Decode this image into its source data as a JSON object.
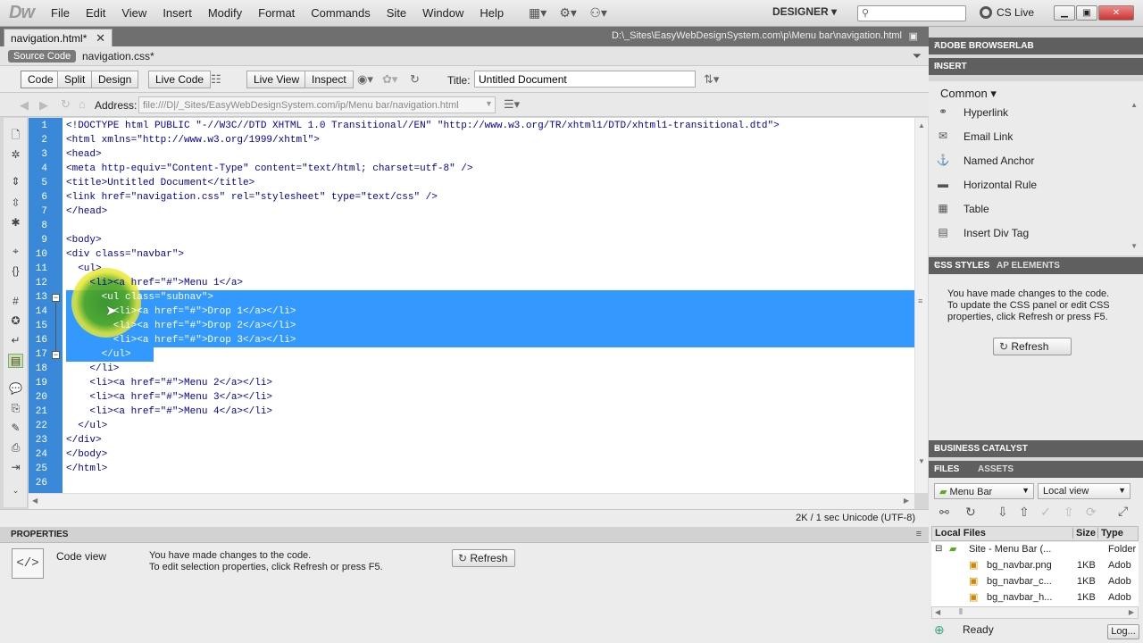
{
  "app": {
    "logo": "Dw"
  },
  "menubar": {
    "items": [
      "File",
      "Edit",
      "View",
      "Insert",
      "Modify",
      "Format",
      "Commands",
      "Site",
      "Window",
      "Help"
    ],
    "workspace": "DESIGNER",
    "cslive": "CS Live"
  },
  "tabs": {
    "active": "navigation.html*",
    "path": "D:\\_Sites\\EasyWebDesignSystem.com\\p\\Menu bar\\navigation.html"
  },
  "related": {
    "source": "Source Code",
    "css": "navigation.css*"
  },
  "doctoolbar": {
    "code": "Code",
    "split": "Split",
    "design": "Design",
    "livecode": "Live Code",
    "liveview": "Live View",
    "inspect": "Inspect",
    "title_label": "Title:",
    "title_value": "Untitled Document"
  },
  "address": {
    "label": "Address:",
    "value": "file:///D|/_Sites/EasyWebDesignSystem.com/ip/Menu bar/navigation.html"
  },
  "code_lines": [
    "<!DOCTYPE html PUBLIC \"-//W3C//DTD XHTML 1.0 Transitional//EN\" \"http://www.w3.org/TR/xhtml1/DTD/xhtml1-transitional.dtd\">",
    "<html xmlns=\"http://www.w3.org/1999/xhtml\">",
    "<head>",
    "<meta http-equiv=\"Content-Type\" content=\"text/html; charset=utf-8\" />",
    "<title>Untitled Document</title>",
    "<link href=\"navigation.css\" rel=\"stylesheet\" type=\"text/css\" />",
    "</head>",
    "",
    "<body>",
    "<div class=\"navbar\">",
    "  <ul>",
    "    <li><a href=\"#\">Menu 1</a>",
    "      <ul class=\"subnav\">",
    "        <li><a href=\"#\">Drop 1</a></li>",
    "        <li><a href=\"#\">Drop 2</a></li>",
    "        <li><a href=\"#\">Drop 3</a></li>",
    "      </ul>",
    "    </li>",
    "    <li><a href=\"#\">Menu 2</a></li>",
    "    <li><a href=\"#\">Menu 3</a></li>",
    "    <li><a href=\"#\">Menu 4</a></li>",
    "  </ul>",
    "</div>",
    "</body>",
    "</html>",
    ""
  ],
  "status": {
    "text": "2K / 1 sec  Unicode (UTF-8)"
  },
  "properties": {
    "title": "PROPERTIES",
    "view": "Code view",
    "msg1": "You have made changes to the code.",
    "msg2": "To edit selection properties, click Refresh or press F5.",
    "refresh": "Refresh"
  },
  "panels": {
    "browserlab": "ADOBE BROWSERLAB",
    "insert": "INSERT",
    "common": "Common",
    "insert_items": [
      "Hyperlink",
      "Email Link",
      "Named Anchor",
      "Horizontal Rule",
      "Table",
      "Insert Div Tag"
    ],
    "css_tab": "CSS STYLES",
    "ap_tab": "AP ELEMENTS",
    "css_msg": [
      "You have made changes to the code.",
      "To update the CSS panel or edit CSS",
      "properties, click Refresh or press F5."
    ],
    "css_refresh": "Refresh",
    "bc": "BUSINESS CATALYST",
    "files_tab": "FILES",
    "assets_tab": "ASSETS",
    "site_select": "Menu Bar",
    "view_select": "Local view",
    "files_header": {
      "name": "Local Files",
      "size": "Size",
      "type": "Type"
    },
    "files": [
      {
        "name": "Site - Menu Bar (...",
        "size": "",
        "type": "Folder"
      },
      {
        "name": "bg_navbar.png",
        "size": "1KB",
        "type": "Adob"
      },
      {
        "name": "bg_navbar_c...",
        "size": "1KB",
        "type": "Adob"
      },
      {
        "name": "bg_navbar_h...",
        "size": "1KB",
        "type": "Adob"
      }
    ],
    "ready": "Ready",
    "log": "Log..."
  }
}
